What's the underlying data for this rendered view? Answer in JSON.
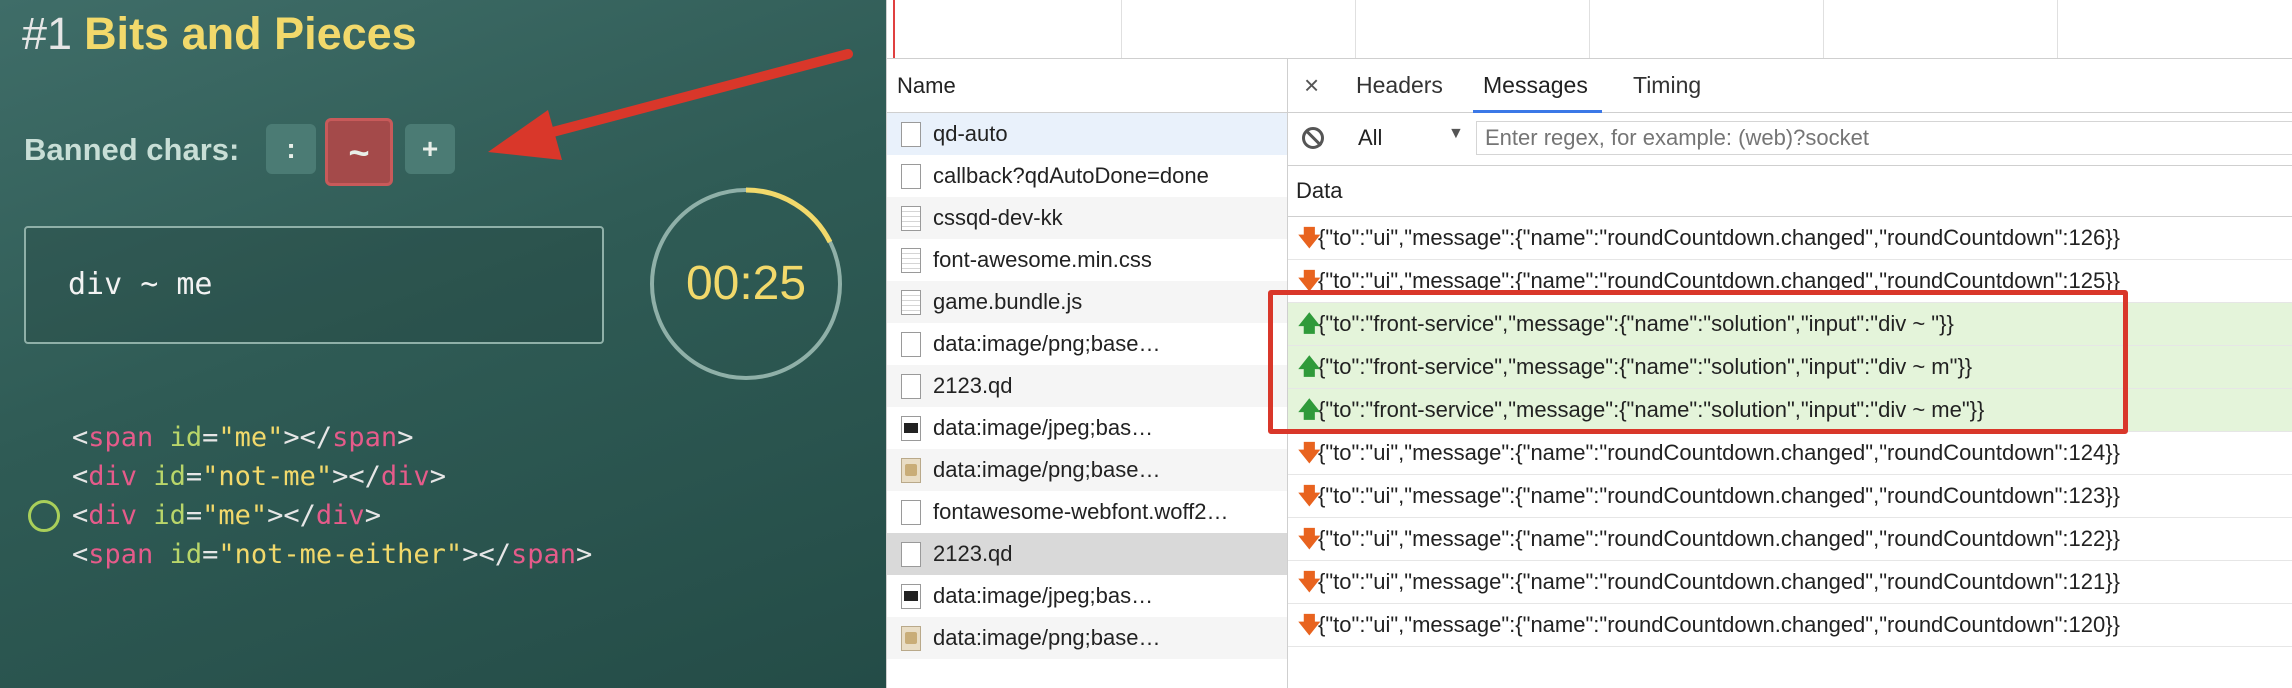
{
  "game": {
    "level_number": "#1",
    "title": "Bits and Pieces",
    "banned_label": "Banned chars:",
    "banned_chars": [
      ":",
      "~",
      "+"
    ],
    "editor_value": "div ~ me",
    "timer": "00:25",
    "code": {
      "line1": {
        "open_tag": "span",
        "attr": "id",
        "value": "\"me\"",
        "close_tag": "span"
      },
      "line2": {
        "open_tag": "div",
        "attr": "id",
        "value": "\"not-me\"",
        "close_tag": "div"
      },
      "line3": {
        "open_tag": "div",
        "attr": "id",
        "value": "\"me\"",
        "close_tag": "div"
      },
      "line4": {
        "open_tag": "span",
        "attr": "id",
        "value": "\"not-me-either\"",
        "close_tag": "span"
      }
    }
  },
  "devtools": {
    "name_header": "Name",
    "requests": [
      {
        "name": "qd-auto",
        "icon": "blank-file-icon"
      },
      {
        "name": "callback?qdAutoDone=done",
        "icon": "blank-file-icon"
      },
      {
        "name": "cssqd-dev-kk",
        "icon": "text-file-icon"
      },
      {
        "name": "font-awesome.min.css",
        "icon": "text-file-icon"
      },
      {
        "name": "game.bundle.js",
        "icon": "text-file-icon"
      },
      {
        "name": "data:image/png;base…",
        "icon": "blank-file-icon"
      },
      {
        "name": "2123.qd",
        "icon": "blank-file-icon"
      },
      {
        "name": "data:image/jpeg;bas…",
        "icon": "jpeg-image-icon"
      },
      {
        "name": "data:image/png;base…",
        "icon": "png-image-icon"
      },
      {
        "name": "fontawesome-webfont.woff2…",
        "icon": "blank-file-icon"
      },
      {
        "name": "2123.qd",
        "icon": "blank-file-icon"
      },
      {
        "name": "data:image/jpeg;bas…",
        "icon": "jpeg-image-icon"
      },
      {
        "name": "data:image/png;base…",
        "icon": "png-image-icon"
      }
    ],
    "tabs": {
      "close": "×",
      "headers": "Headers",
      "messages": "Messages",
      "timing": "Timing"
    },
    "filter": {
      "select": "All",
      "placeholder": "Enter regex, for example: (web)?socket"
    },
    "data_header": "Data",
    "messages": [
      {
        "dir": "down",
        "text": "{\"to\":\"ui\",\"message\":{\"name\":\"roundCountdown.changed\",\"roundCountdown\":126}}"
      },
      {
        "dir": "down",
        "text": "{\"to\":\"ui\",\"message\":{\"name\":\"roundCountdown.changed\",\"roundCountdown\":125}}"
      },
      {
        "dir": "up",
        "text": "{\"to\":\"front-service\",\"message\":{\"name\":\"solution\",\"input\":\"div ~ \"}}"
      },
      {
        "dir": "up",
        "text": "{\"to\":\"front-service\",\"message\":{\"name\":\"solution\",\"input\":\"div ~ m\"}}"
      },
      {
        "dir": "up",
        "text": "{\"to\":\"front-service\",\"message\":{\"name\":\"solution\",\"input\":\"div ~ me\"}}"
      },
      {
        "dir": "down",
        "text": "{\"to\":\"ui\",\"message\":{\"name\":\"roundCountdown.changed\",\"roundCountdown\":124}}"
      },
      {
        "dir": "down",
        "text": "{\"to\":\"ui\",\"message\":{\"name\":\"roundCountdown.changed\",\"roundCountdown\":123}}"
      },
      {
        "dir": "down",
        "text": "{\"to\":\"ui\",\"message\":{\"name\":\"roundCountdown.changed\",\"roundCountdown\":122}}"
      },
      {
        "dir": "down",
        "text": "{\"to\":\"ui\",\"message\":{\"name\":\"roundCountdown.changed\",\"roundCountdown\":121}}"
      },
      {
        "dir": "down",
        "text": "{\"to\":\"ui\",\"message\":{\"name\":\"roundCountdown.changed\",\"roundCountdown\":120}}"
      }
    ]
  },
  "colors": {
    "title_yellow": "#f2d96b",
    "banned_active": "#a44a4a",
    "arrow_red": "#d9372a",
    "incoming_arrow": "#e8631f",
    "outgoing_arrow": "#2f9a3a",
    "outgoing_row": "#e4f4da"
  }
}
